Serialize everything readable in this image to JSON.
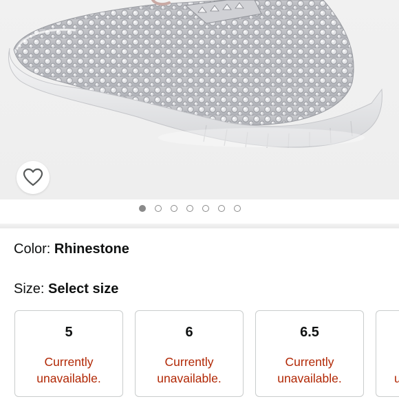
{
  "gallery": {
    "image_count": 7,
    "active_index": 0
  },
  "color": {
    "label": "Color:",
    "value": "Rhinestone"
  },
  "size": {
    "label": "Size:",
    "value": "Select size",
    "options": [
      {
        "size": "5",
        "line1": "Currently",
        "line2": "unavailable."
      },
      {
        "size": "6",
        "line1": "Currently",
        "line2": "unavailable."
      },
      {
        "size": "6.5",
        "line1": "Currently",
        "line2": "unavailable."
      },
      {
        "size": "",
        "line1": "",
        "line2": "u"
      }
    ]
  },
  "colors": {
    "unavailable_text": "#b12704",
    "tile_border": "#c9cccc",
    "dot": "#8a8a8a"
  },
  "icons": {
    "wishlist": "heart-outline-icon"
  }
}
